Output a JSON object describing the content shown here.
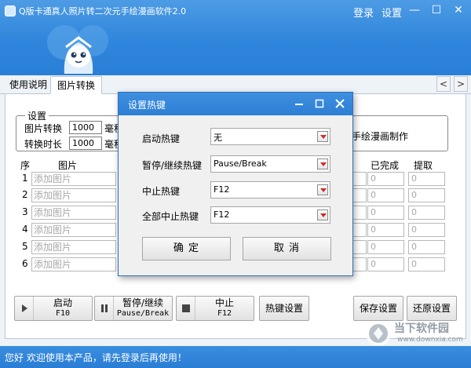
{
  "window": {
    "title": "Q版卡通真人照片转二次元手绘漫画软件2.0",
    "login": "登录",
    "settings": "设置",
    "minimize": "—",
    "maximize": "☐",
    "close": "✕"
  },
  "tabs": [
    {
      "label": "使用说明"
    },
    {
      "label": "图片转换"
    }
  ],
  "tab_scroll": {
    "left": "<",
    "right": ">"
  },
  "settings_group": {
    "legend": "设置",
    "convert_label": "图片转换",
    "convert_value": "1000",
    "convert_unit": "毫秒",
    "duration_label": "转换时长",
    "duration_value": "1000",
    "duration_unit": "毫秒",
    "right_text": "手绘漫画制作"
  },
  "list": {
    "col_index": "序",
    "col_image": "图片",
    "col_done": "已完成",
    "col_extract": "提取",
    "placeholder": "添加图片",
    "rows": [
      {
        "num": "1",
        "done": "0",
        "extract": "0"
      },
      {
        "num": "2",
        "done": "0",
        "extract": "0"
      },
      {
        "num": "3",
        "done": "0",
        "extract": "0"
      },
      {
        "num": "4",
        "done": "0",
        "extract": "0"
      },
      {
        "num": "5",
        "done": "0",
        "extract": "0"
      },
      {
        "num": "6",
        "done": "0",
        "extract": "0"
      }
    ]
  },
  "buttons": {
    "start": {
      "label": "启动",
      "key": "F10"
    },
    "pause": {
      "label": "暂停/继续",
      "key": "Pause/Break"
    },
    "stop": {
      "label": "中止",
      "key": "F12"
    },
    "hotkey": "热键设置",
    "save": "保存设置",
    "restore": "还原设置"
  },
  "status": "您好 欢迎使用本产品，请先登录后再使用！",
  "dialog": {
    "title": "设置热键",
    "fields": [
      {
        "label": "启动热键",
        "value": "无"
      },
      {
        "label": "暂停/继续热键",
        "value": "Pause/Break"
      },
      {
        "label": "中止热键",
        "value": "F12"
      },
      {
        "label": "全部中止热键",
        "value": "F12"
      }
    ],
    "ok": "确 定",
    "cancel": "取 消"
  },
  "watermark": {
    "brand": "当下软件园",
    "url": "www.downxia.com"
  },
  "colors": {
    "title_bar": "#2f86dc",
    "dropdown_arrow": "#d12a2a"
  }
}
